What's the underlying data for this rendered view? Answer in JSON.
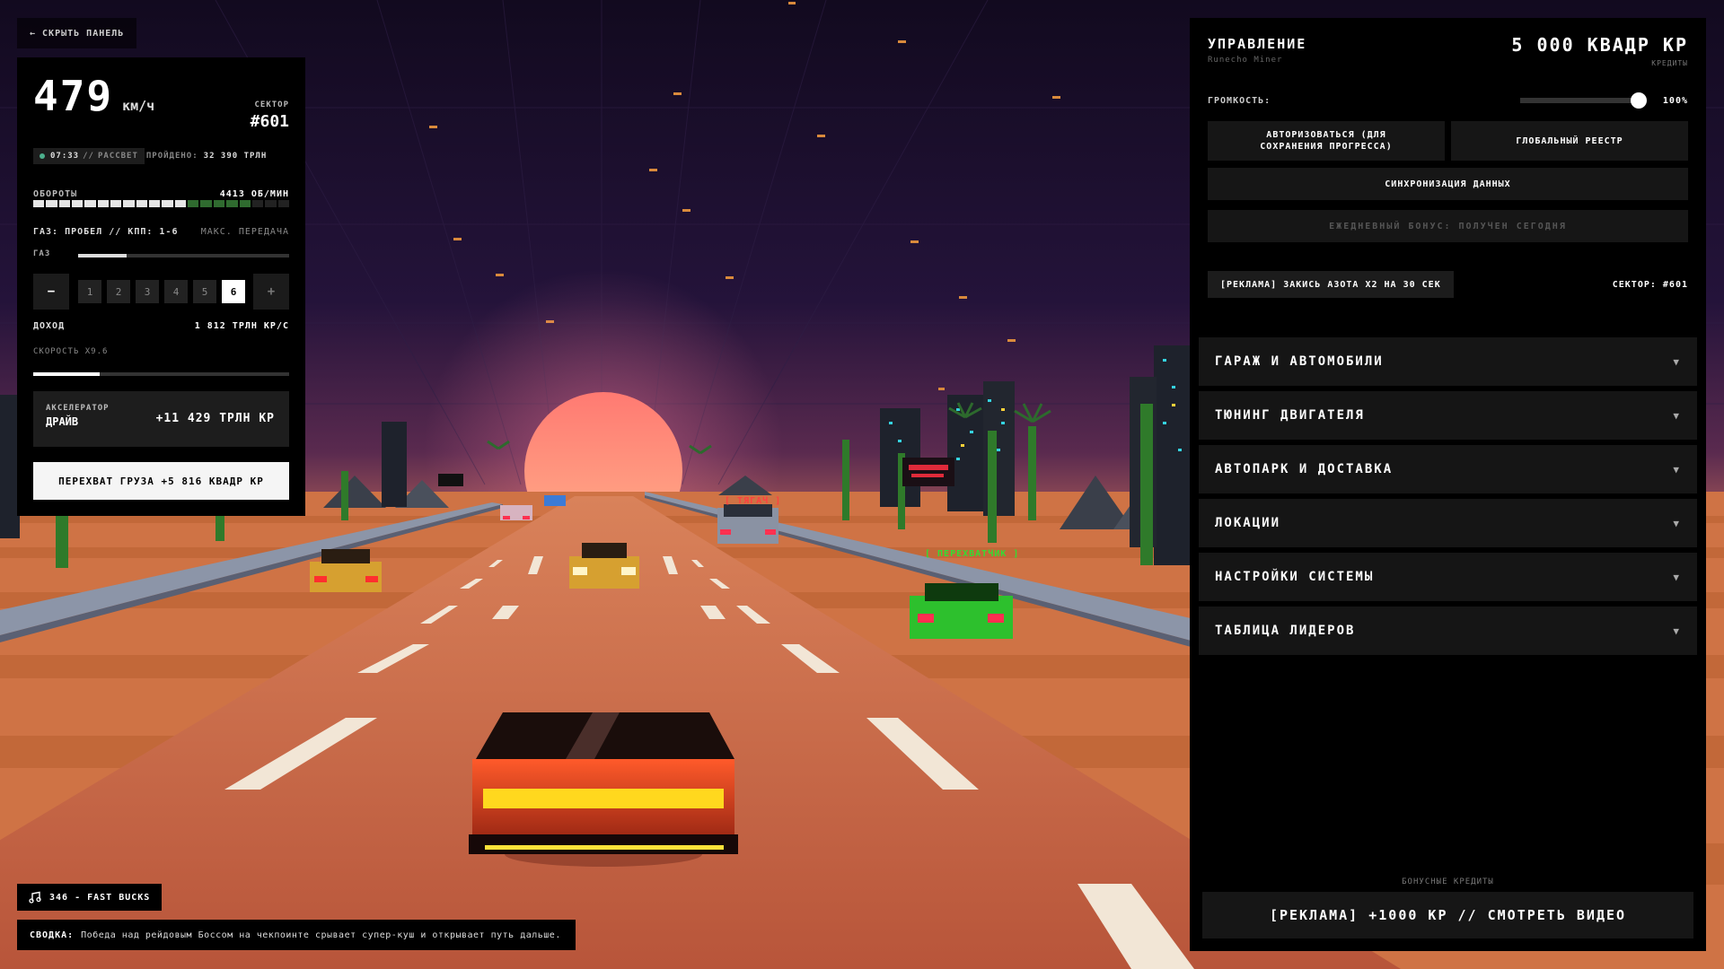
{
  "hud": {
    "hide_label": "← СКРЫТЬ ПАНЕЛЬ",
    "speed": "479",
    "speed_unit": "км/ч",
    "sector_label": "СЕКТОР",
    "sector_value": "#601",
    "time": "07:33",
    "time_sep": "//",
    "time_phase": "РАССВЕТ",
    "passed_label": "ПРОЙДЕНО:",
    "passed_value": "32 390 ТРЛН",
    "rpm_label": "ОБОРОТЫ",
    "rpm_value": "4413 ОБ/МИН",
    "rpm_level": 0.6,
    "gas_hint": "ГАЗ: ПРОБЕЛ // КПП: 1-6",
    "max_gear_label": "МАКС. ПЕРЕДАЧА",
    "gas_label": "ГАЗ",
    "gas_level": 0.23,
    "gear_minus": "−",
    "gear_plus": "+",
    "gears": [
      "1",
      "2",
      "3",
      "4",
      "5",
      "6"
    ],
    "current_gear": "6",
    "income_label": "ДОХОД",
    "income_value": "1 812 ТРЛН КР/С",
    "speed_mult_label": "СКОРОСТЬ X9.6",
    "speed_mult_level": 0.26,
    "accel_label": "АКСЕЛЕРАТОР",
    "accel_name": "ДРАЙВ",
    "accel_value": "+11 429 ТРЛН КР",
    "intercept_label": "ПЕРЕХВАТ ГРУЗА +5 816 КВАДР КР"
  },
  "music": {
    "icon": "music-note-icon",
    "track": "346 - FAST BUCKS"
  },
  "summary": {
    "label": "СВОДКА:",
    "text": "Победа над рейдовым Боссом на чекпоинте срывает супер-куш и открывает путь дальше."
  },
  "scene": {
    "tag_tow": "[ ТЯГАЧ ]",
    "tag_interceptor": "[ ПЕРЕХВАТЧИК ]"
  },
  "panel": {
    "title": "УПРАВЛЕНИЕ",
    "subtitle": "Runecho Miner",
    "credits_value": "5 000 КВАДР КР",
    "credits_label": "КРЕДИТЫ",
    "volume_label": "ГРОМКОСТЬ:",
    "volume_value": "100%",
    "volume_level": 1.0,
    "auth_button": "АВТОРИЗОВАТЬСЯ (ДЛЯ СОХРАНЕНИЯ ПРОГРЕССА)",
    "registry_button": "ГЛОБАЛЬНЫЙ РЕЕСТР",
    "sync_button": "СИНХРОНИЗАЦИЯ ДАННЫХ",
    "daily_bonus": "ЕЖЕДНЕВНЫЙ БОНУС: ПОЛУЧЕН СЕГОДНЯ",
    "ad_nitro": "[РЕКЛАМА] ЗАКИСЬ АЗОТА X2 НА 30 СЕК",
    "sector_label": "СЕКТОР: #601",
    "sections": [
      "ГАРАЖ И АВТОМОБИЛИ",
      "ТЮНИНГ ДВИГАТЕЛЯ",
      "АВТОПАРК И ДОСТАВКА",
      "ЛОКАЦИИ",
      "НАСТРОЙКИ СИСТЕМЫ",
      "ТАБЛИЦА ЛИДЕРОВ"
    ],
    "chevron": "▼",
    "bonus_label": "БОНУСНЫЕ КРЕДИТЫ",
    "bonus_button": "[РЕКЛАМА] +1000 КР // СМОТРЕТЬ ВИДЕО"
  },
  "colors": {
    "sky_top": "#120a1f",
    "sun": "#ff8a78",
    "road": "#c8663f",
    "ground": "#d27a45",
    "rpm_on": "#e6e6e6",
    "rpm_warn": "#2f6b2f",
    "tag_tow": "#ff4040",
    "tag_interceptor": "#33dd33"
  }
}
